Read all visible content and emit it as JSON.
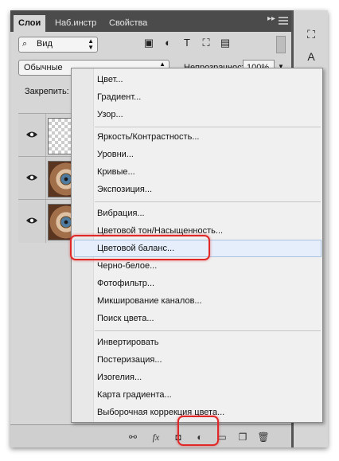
{
  "tabs": [
    {
      "label": "Слои",
      "active": true
    },
    {
      "label": "Наб.инстр",
      "active": false
    },
    {
      "label": "Свойства",
      "active": false
    }
  ],
  "filter": {
    "kind_label": "Вид",
    "icons": [
      "image-filter-icon",
      "adjustment-filter-icon",
      "type-filter-icon",
      "shape-filter-icon",
      "smart-object-filter-icon"
    ]
  },
  "blend_mode": "Обычные",
  "opacity": {
    "label": "Непрозрачность:",
    "value": "100%"
  },
  "lock_label": "Закрепить:",
  "layers": [
    {
      "thumb": "transparent",
      "visible": true
    },
    {
      "thumb": "eye-photo",
      "visible": true
    },
    {
      "thumb": "eye-photo",
      "visible": true
    }
  ],
  "menu": {
    "items": [
      "Цвет...",
      "Градиент...",
      "Узор...",
      "Яркость/Контрастность...",
      "Уровни...",
      "Кривые...",
      "Экспозиция...",
      "Вибрация...",
      "Цветовой тон/Насыщенность...",
      "Цветовой баланс...",
      "Черно-белое...",
      "Фотофильтр...",
      "Микширование каналов...",
      "Поиск цвета...",
      "Инвертировать",
      "Постеризация...",
      "Изогелия...",
      "Карта градиента...",
      "Выборочная коррекция цвета..."
    ],
    "highlighted": "Цветовой баланс..."
  },
  "bottom_icons": [
    "link-layers-icon",
    "fx-icon",
    "add-mask-icon",
    "new-adjustment-layer-icon",
    "new-group-icon",
    "new-layer-icon",
    "delete-layer-icon"
  ],
  "colors": {
    "highlight_ring": "#e02828",
    "panel": "#d6d6d6",
    "menu_bg": "#f0f0f0"
  }
}
